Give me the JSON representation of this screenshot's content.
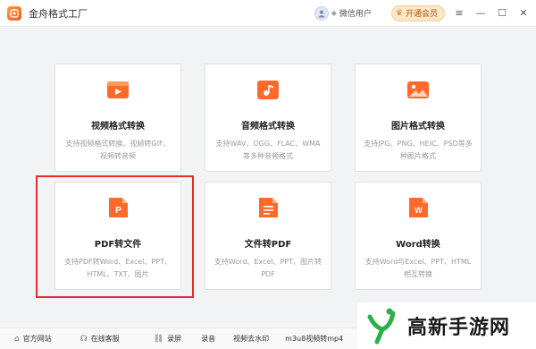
{
  "app": {
    "title": "金舟格式工厂"
  },
  "header": {
    "user_name": "微信用户",
    "vip_button": "开通会员",
    "menu_icon": "≡",
    "min_icon": "—",
    "max_icon": "☐",
    "close_icon": "✕"
  },
  "cards": [
    {
      "title": "视频格式转换",
      "desc": "支持视频格式转换、视频转GIF、视频转音频",
      "icon": "video-icon"
    },
    {
      "title": "音频格式转换",
      "desc": "支持WAV、OGG、FLAC、WMA等多种音频格式",
      "icon": "audio-icon"
    },
    {
      "title": "图片格式转换",
      "desc": "支持JPG、PNG、HEIC、PSD等多种图片格式",
      "icon": "image-icon"
    },
    {
      "title": "PDF转文件",
      "desc": "支持PDF转Word、Excel、PPT、HTML、TXT、图片",
      "icon": "pdf-icon",
      "glyph": "P"
    },
    {
      "title": "文件转PDF",
      "desc": "支持Word、Excel、PPT、图片转PDF",
      "icon": "file-to-pdf-icon"
    },
    {
      "title": "Word转换",
      "desc": "支持Word与Excel、PPT、HTML相互转换",
      "icon": "word-icon",
      "glyph": "W"
    }
  ],
  "bottom": {
    "website": "官方网站",
    "service": "在线客服",
    "record": "录屏",
    "audio": "录音",
    "watermark_tool": "视频去水印",
    "m3u8": "m3u8视频转mp4"
  },
  "watermark": {
    "text": "高新手游网"
  },
  "colors": {
    "accent": "#ff6a2b",
    "highlight": "#e52c2c",
    "vip": "#fbe7c8"
  }
}
